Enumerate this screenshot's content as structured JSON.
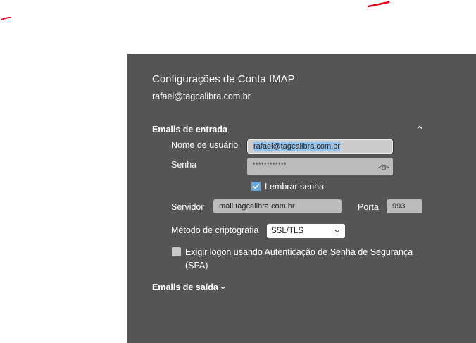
{
  "dialog": {
    "title": "Configurações de Conta IMAP",
    "account_email": "rafael@tagcalibra.com.br"
  },
  "incoming": {
    "header": "Emails de entrada",
    "collapse_icon": "chevron-up-icon",
    "username_label": "Nome de usuário",
    "username_value": "rafael@tagcalibra.com.br",
    "password_label": "Senha",
    "password_value": "************",
    "show_password_icon": "eye-icon",
    "remember_password_label": "Lembrar senha",
    "remember_password_checked": true,
    "server_label": "Servidor",
    "server_value": "mail.tagcalibra.com.br",
    "port_label": "Porta",
    "port_value": "993",
    "encryption_label": "Método de criptografia",
    "encryption_value": "SSL/TLS",
    "spa_label_line1": "Exigir logon usando Autenticação de Senha de Segurança",
    "spa_label_line2": "(SPA)",
    "spa_checked": false
  },
  "outgoing": {
    "header": "Emails de saída",
    "expand_icon": "chevron-down-icon"
  },
  "colors": {
    "panel_background": "#555555",
    "checkbox_accent": "#6aa9e0",
    "text_selection": "#99c4ec",
    "pen_annotation": "#e0001a"
  }
}
